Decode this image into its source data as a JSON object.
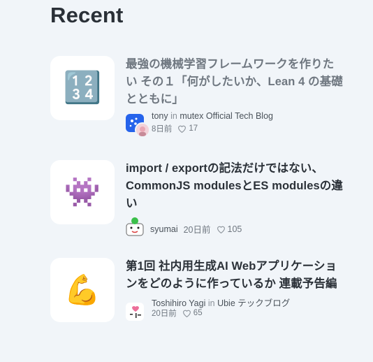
{
  "section": {
    "heading": "Recent"
  },
  "articles": [
    {
      "emoji": "🔢",
      "title": "最強の機械学習フレームワークを作りたい その１「何がしたいか、Lean 4 の基礎とともに」",
      "author": "tony",
      "in_word": "in",
      "publication": "mutex Official Tech Blog",
      "date": "8日前",
      "likes": "17"
    },
    {
      "emoji": "👾",
      "title": "import / exportの記法だけではない、CommonJS modulesとES modulesの違い",
      "author": "syumai",
      "date": "20日前",
      "likes": "105"
    },
    {
      "emoji": "💪",
      "title": "第1回 社内用生成AI Webアプリケーションをどのように作っているか 連載予告編",
      "author": "Toshihiro Yagi",
      "in_word": "in",
      "publication": "Ubie テックブログ",
      "date": "20日前",
      "likes": "65"
    }
  ]
}
